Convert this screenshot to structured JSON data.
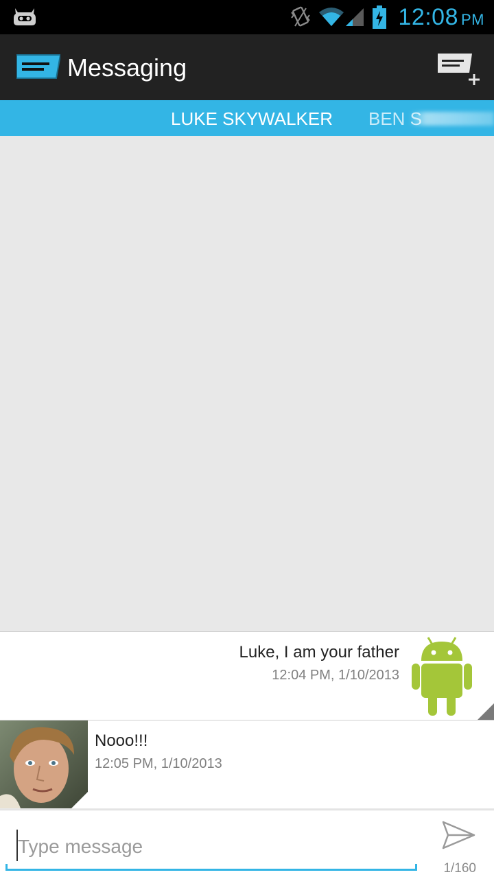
{
  "status_bar": {
    "time": "12:08",
    "ampm": "PM",
    "icons": [
      "cyanogenmod-icon",
      "vibrate-icon",
      "wifi-icon",
      "signal-icon",
      "battery-charging-icon"
    ],
    "accent": "#33b5e5"
  },
  "action_bar": {
    "title": "Messaging",
    "app_icon": "messaging-app-icon",
    "compose_icon": "new-message-icon"
  },
  "tabs": [
    {
      "label": "LUKE SKYWALKER",
      "active": true
    },
    {
      "label": "BEN S",
      "active": false
    }
  ],
  "messages": [
    {
      "direction": "outgoing",
      "text": "Luke, I am your father",
      "time": "12:04 PM, 1/10/2013",
      "avatar": "android-robot-avatar"
    },
    {
      "direction": "incoming",
      "text": "Nooo!!!",
      "time": "12:05 PM, 1/10/2013",
      "avatar": "contact-photo-avatar"
    }
  ],
  "composer": {
    "placeholder": "Type message",
    "value": "",
    "counter": "1/160",
    "send_icon": "send-icon"
  },
  "colors": {
    "accent": "#33b5e5",
    "action_bar": "#222222",
    "thread_bg": "#e8e8e8",
    "android_green": "#a4c639"
  }
}
